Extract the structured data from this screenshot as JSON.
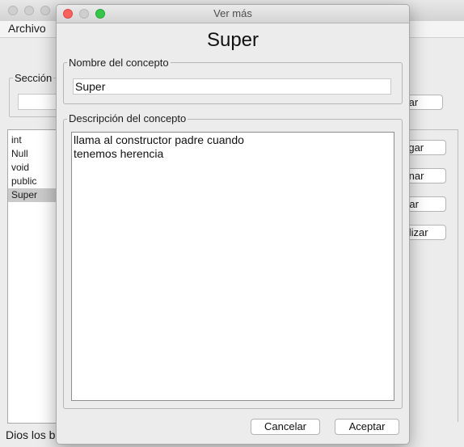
{
  "parent_window": {
    "menu": {
      "archivo": "Archivo"
    },
    "seccion_label": "Sección",
    "list_items": [
      "int",
      "Null",
      "void",
      "public",
      "Super"
    ],
    "selected_item": "Super",
    "right_buttons": [
      "Buscar",
      "Agregar",
      "Eliminar",
      "Editar",
      "Actualizar"
    ],
    "footer_text": "Dios los b"
  },
  "dialog": {
    "window_title": "Ver más",
    "heading": "Super",
    "name_group": {
      "legend": "Nombre del concepto",
      "value": "Super"
    },
    "description_group": {
      "legend": "Descripción del concepto",
      "lines": [
        "llama al constructor padre cuando",
        "tenemos herencia"
      ]
    },
    "buttons": {
      "cancel": "Cancelar",
      "accept": "Aceptar"
    }
  }
}
